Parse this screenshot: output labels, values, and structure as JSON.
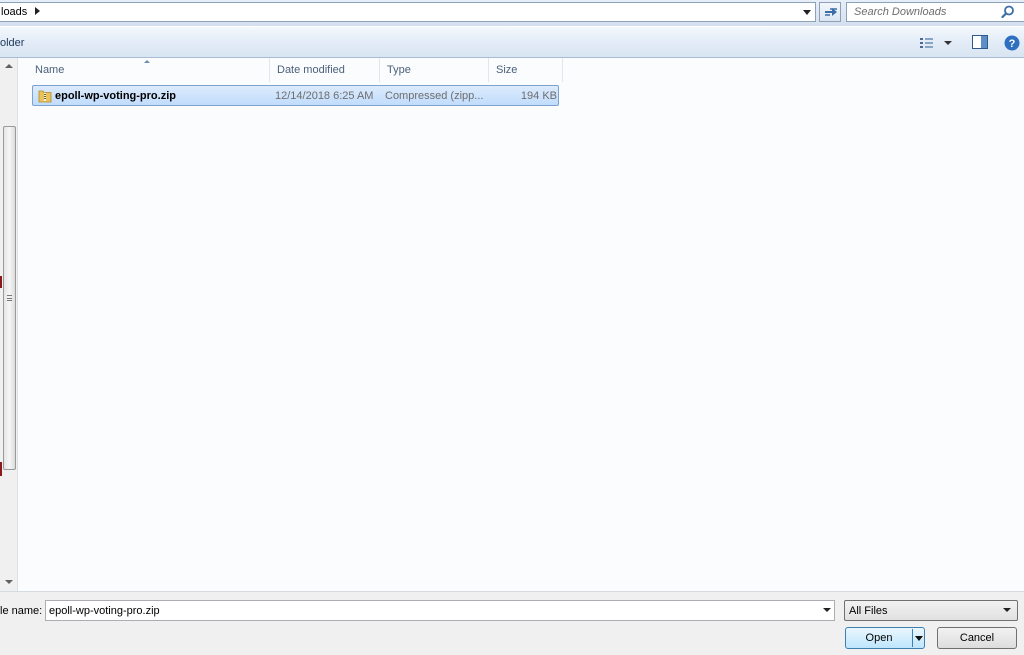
{
  "address": {
    "path_text": "loads",
    "search_placeholder": "Search Downloads"
  },
  "toolbar": {
    "new_folder_label": "older"
  },
  "columns": {
    "name": "Name",
    "date_modified": "Date modified",
    "type": "Type",
    "size": "Size"
  },
  "files": [
    {
      "name": "epoll-wp-voting-pro.zip",
      "date_modified": "12/14/2018 6:25 AM",
      "type": "Compressed (zipp...",
      "size": "194 KB"
    }
  ],
  "bottom": {
    "filename_label": "le name:",
    "filename_value": "epoll-wp-voting-pro.zip",
    "filter_value": "All Files",
    "open_label": "Open",
    "cancel_label": "Cancel"
  },
  "colors": {
    "selection_fill": "#c1dcfc",
    "selection_border": "#7da2ce",
    "header_text": "#4c607a",
    "toolbar_text": "#1e395b"
  }
}
